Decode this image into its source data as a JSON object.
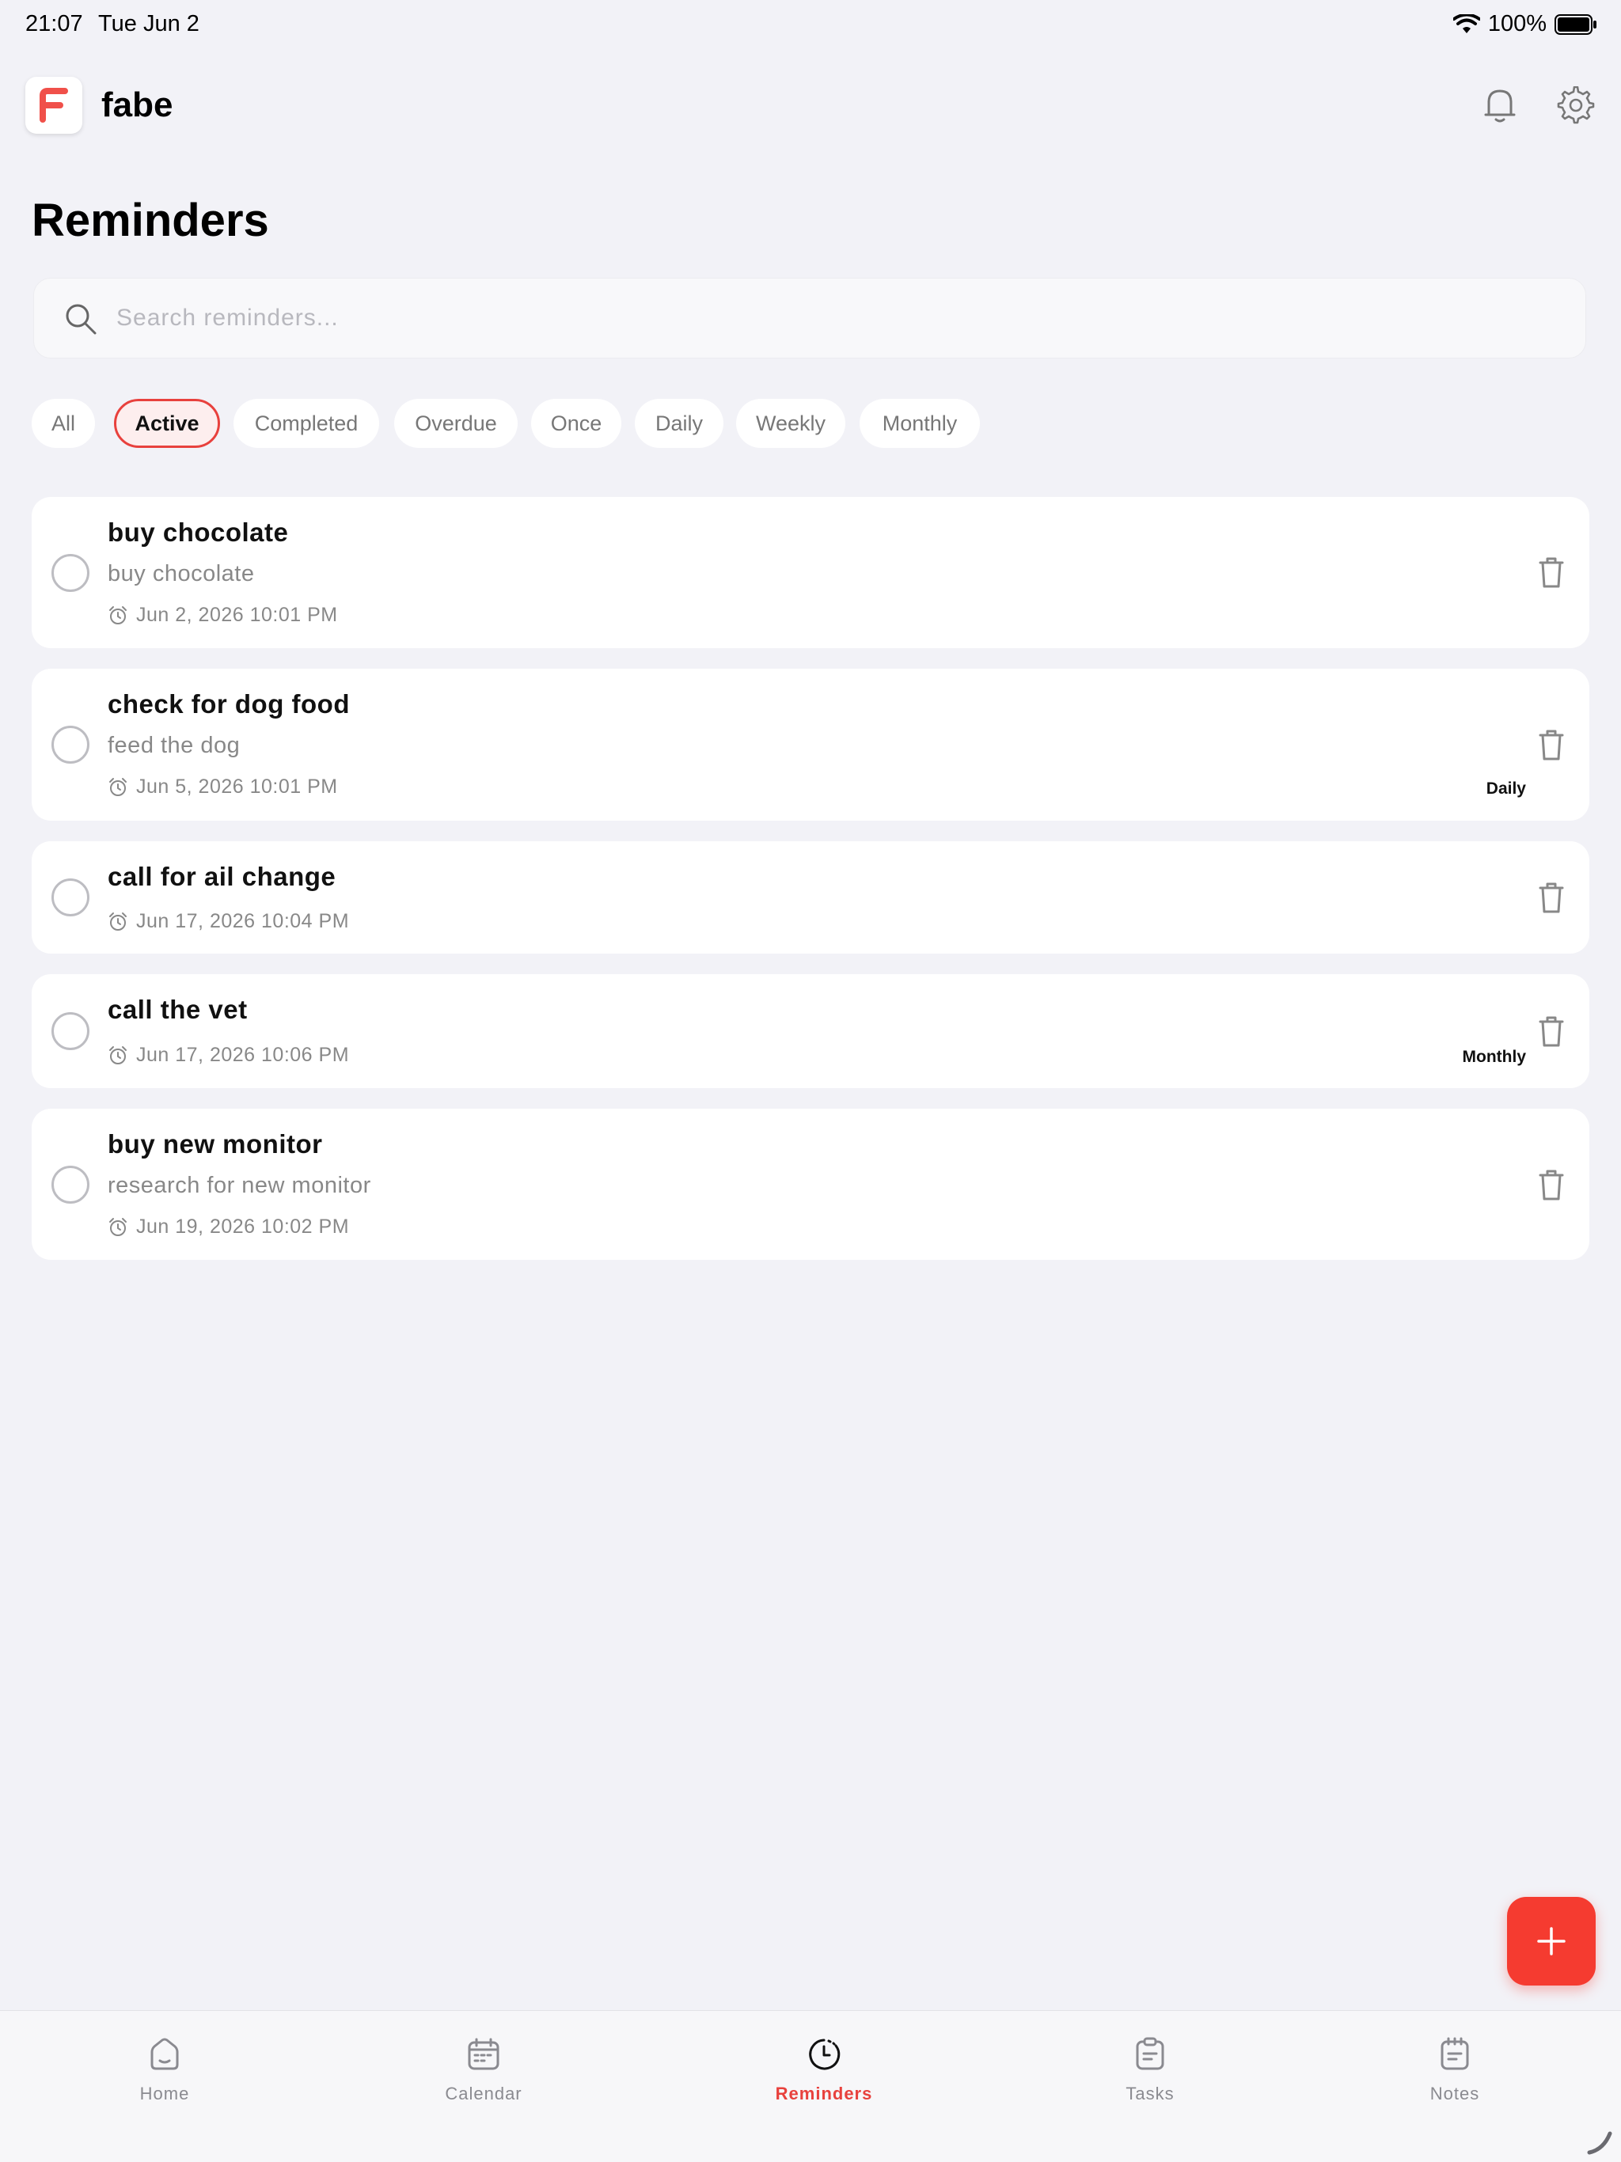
{
  "status_bar": {
    "time": "21:07",
    "date": "Tue Jun 2",
    "battery": "100%"
  },
  "header": {
    "app_name": "fabe",
    "logo_letter": "F",
    "accent_color": "#e8413d"
  },
  "page": {
    "title": "Reminders"
  },
  "search": {
    "placeholder": "Search reminders...",
    "value": ""
  },
  "filters": [
    {
      "label": "All",
      "active": false
    },
    {
      "label": "Active",
      "active": true
    },
    {
      "label": "Completed",
      "active": false
    },
    {
      "label": "Overdue",
      "active": false
    },
    {
      "label": "Once",
      "active": false
    },
    {
      "label": "Daily",
      "active": false
    },
    {
      "label": "Weekly",
      "active": false
    },
    {
      "label": "Monthly",
      "active": false
    }
  ],
  "reminders": [
    {
      "title": "buy chocolate",
      "description": "buy chocolate",
      "datetime": "Jun 2, 2026 10:01 PM",
      "repeat": "",
      "completed": false
    },
    {
      "title": "check for dog food",
      "description": "feed the dog",
      "datetime": "Jun 5, 2026 10:01 PM",
      "repeat": "Daily",
      "completed": false
    },
    {
      "title": "call for ail change",
      "description": "",
      "datetime": "Jun 17, 2026 10:04 PM",
      "repeat": "",
      "completed": false
    },
    {
      "title": "call the vet",
      "description": "",
      "datetime": "Jun 17, 2026 10:06 PM",
      "repeat": "Monthly",
      "completed": false
    },
    {
      "title": "buy new monitor",
      "description": "research for new monitor",
      "datetime": "Jun 19, 2026 10:02 PM",
      "repeat": "",
      "completed": false
    }
  ],
  "nav": [
    {
      "label": "Home",
      "icon": "home-icon",
      "active": false
    },
    {
      "label": "Calendar",
      "icon": "calendar-icon",
      "active": false
    },
    {
      "label": "Reminders",
      "icon": "clock-icon",
      "active": true
    },
    {
      "label": "Tasks",
      "icon": "clipboard-icon",
      "active": false
    },
    {
      "label": "Notes",
      "icon": "notepad-icon",
      "active": false
    }
  ]
}
